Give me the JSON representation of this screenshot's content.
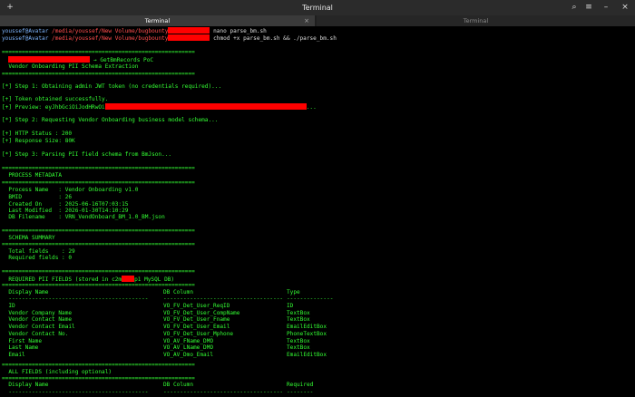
{
  "window": {
    "title": "Terminal",
    "new_tab_icon": "+",
    "search_icon": "⌕",
    "menu_icon": "≡",
    "minimize_icon": "–",
    "close_icon": "×"
  },
  "tabs": [
    {
      "label": "Terminal",
      "close": "×",
      "active": true
    },
    {
      "label": "Terminal",
      "active": false
    }
  ],
  "colors": {
    "terminal_green": "#33ff33",
    "prompt_blue": "#7fb6ff",
    "path_red": "#ff4d4d",
    "redaction": "#ff0000"
  },
  "prompts": [
    {
      "user": "youssef@Avatar",
      "sep": " ",
      "path": "/media/youssef/New Volume/bugbounty",
      "cmd": " nano parse_bm.sh"
    },
    {
      "user": "youssef@Avatar",
      "sep": " ",
      "path": "/media/youssef/New Volume/bugbounty",
      "cmd": " chmod +x parse_bm.sh && ./parse_bm.sh"
    }
  ],
  "output": {
    "sep": "==========================================================",
    "header1": " → GetBmRecords PoC",
    "header2": "  Vendor Onboarding PII Schema Extraction",
    "step1": "[*] Step 1: Obtaining admin JWT token (no credentials required)...",
    "token_ok": "[+] Token obtained successfully.",
    "preview_prefix": "[+] Preview: eyJhbGciOiJodHRwOi",
    "preview_suffix": "...",
    "step2": "[*] Step 2: Requesting Vendor Onboarding business model schema...",
    "http_status": "[+] HTTP Status : 200",
    "resp_size": "[+] Response Size: 80K",
    "step3": "[*] Step 3: Parsing PII field schema from BmJson...",
    "meta_title": "  PROCESS METADATA",
    "meta": [
      "  Process Name   : Vendor Onboarding v1.0",
      "  BMID           : 26",
      "  Created On     : 2025-06-16T07:03:15",
      "  Last Modified  : 2026-01-30T14:10:29",
      "  DB Filename    : VRN_VendOnboard_BM_1.0_BM.json"
    ],
    "summary_title": "  SCHEMA SUMMARY",
    "summary": [
      "  Total fields    : 29",
      "  Required fields : 0"
    ],
    "pii_title_prefix": "  REQUIRED PII FIELDS (stored in c2m",
    "pii_title_suffix": "p1 MySQL DB)",
    "col_display": "  Display Name",
    "col_db": "DB Column",
    "col_type": "Type",
    "dash_a": "  ------------------------------------------",
    "dash_b": "------------------------------------",
    "dash_c": "--------------",
    "pii_rows": [
      {
        "name": "  ID",
        "db": "VO_FV_Det_User_ReqID",
        "type": "ID"
      },
      {
        "name": "  Vendor Company Name",
        "db": "VO_FV_Det_User_CompName",
        "type": "TextBox"
      },
      {
        "name": "  Vendor Contact Name",
        "db": "VO_FV_Det_User_Fname",
        "type": "TextBox"
      },
      {
        "name": "  Vendor Contact Email",
        "db": "VO_FV_Det_User_Email",
        "type": "EmailEditBox"
      },
      {
        "name": "  Vendor Contact No.",
        "db": "VO_FV_Det_User_Mphone",
        "type": "PhoneTextBox"
      },
      {
        "name": "  First Name",
        "db": "VO_AV_FName_DMO",
        "type": "TextBox"
      },
      {
        "name": "  Last Name",
        "db": "VO_AV_LName_DMO",
        "type": "TextBox"
      },
      {
        "name": "  Email",
        "db": "VO_AV_Dmo_Email",
        "type": "EmailEditBox"
      }
    ],
    "all_title": "  ALL FIELDS (including optional)",
    "col_required": "Required",
    "dash_d": "--------"
  }
}
